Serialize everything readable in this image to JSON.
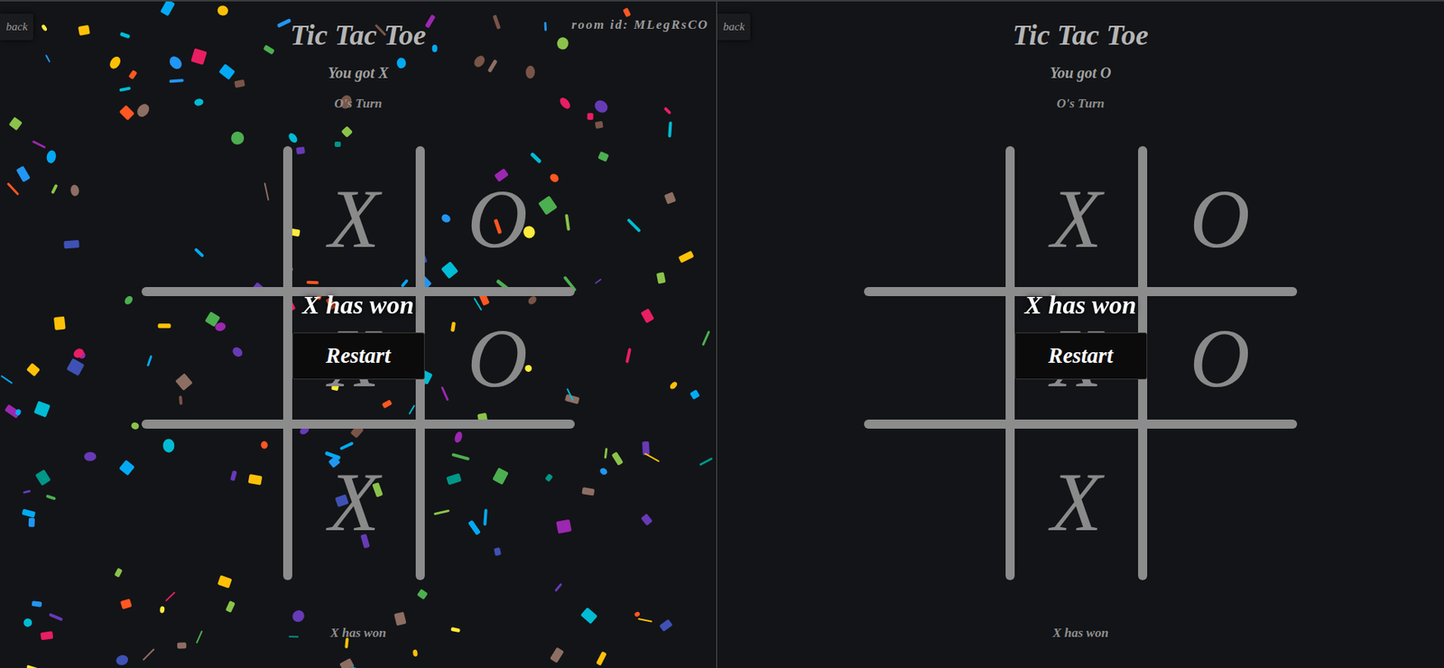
{
  "panels": [
    {
      "back": "back",
      "title": "Tic Tac Toe",
      "room_id": "room id: MLegRsCO",
      "player": "You got X",
      "turn": "O's Turn",
      "board": [
        [
          "",
          "X",
          "O"
        ],
        [
          "",
          "X",
          "O"
        ],
        [
          "",
          "X",
          ""
        ]
      ],
      "result": {
        "message": "X has won",
        "button": "Restart"
      },
      "status": "X has won",
      "confetti": true
    },
    {
      "back": "back",
      "title": "Tic Tac Toe",
      "player": "You got O",
      "turn": "O's Turn",
      "board": [
        [
          "",
          "X",
          "O"
        ],
        [
          "",
          "X",
          "O"
        ],
        [
          "",
          "X",
          ""
        ]
      ],
      "result": {
        "message": "X has won",
        "button": "Restart"
      },
      "status": "X has won",
      "confetti": false
    }
  ]
}
